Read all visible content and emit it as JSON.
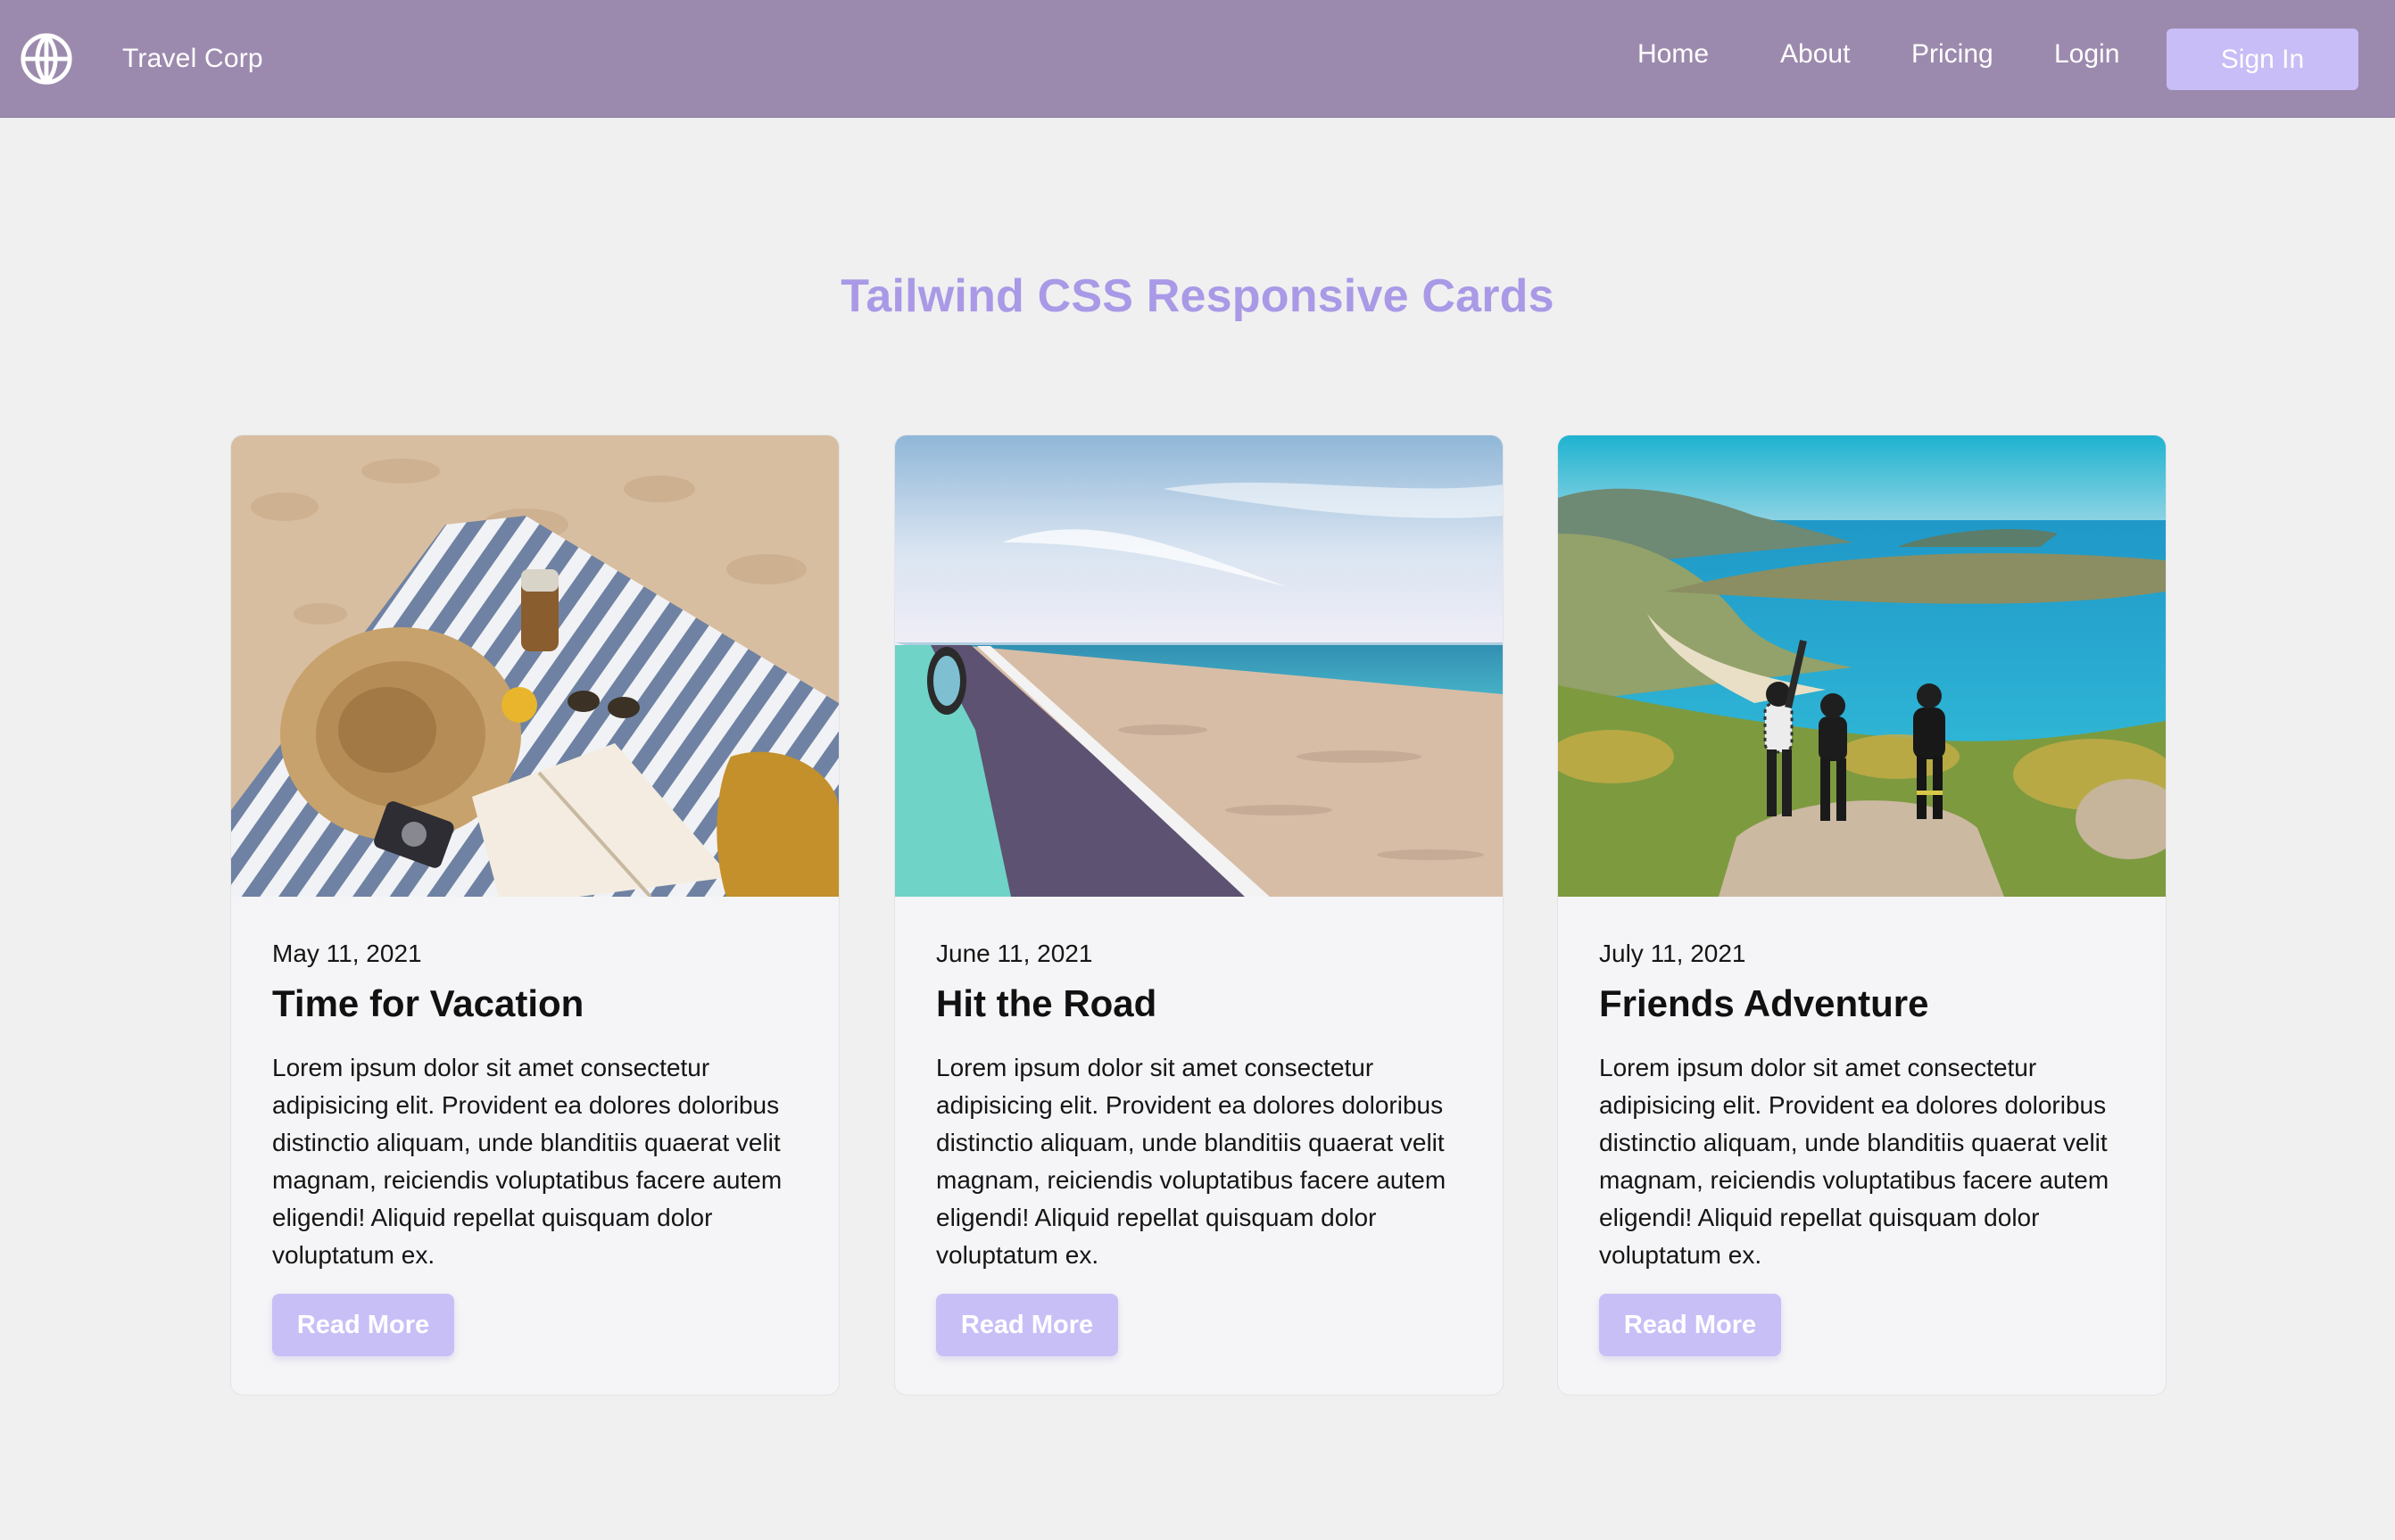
{
  "header": {
    "brand_icon": "globe-icon",
    "brand_name": "Travel Corp",
    "nav": {
      "home": "Home",
      "about": "About",
      "pricing": "Pricing",
      "login": "Login",
      "signin": "Sign In"
    },
    "background_color": "#9c8aae",
    "button_color": "#c8bdf6"
  },
  "page": {
    "title": "Tailwind CSS Responsive Cards",
    "title_color": "#a999e6",
    "background_color": "#f0f0f0"
  },
  "cards": [
    {
      "image": "beach-picnic-photo",
      "date": "May 11, 2021",
      "title": "Time for Vacation",
      "text": "Lorem ipsum dolor sit amet consectetur adipisicing elit. Provident ea dolores doloribus distinctio aliquam, unde blanditiis quaerat velit magnam, reiciendis voluptatibus facere autem eligendi! Aliquid repellat quisquam dolor voluptatum ex.",
      "button": "Read More"
    },
    {
      "image": "coastal-road-photo",
      "date": "June 11, 2021",
      "title": "Hit the Road",
      "text": "Lorem ipsum dolor sit amet consectetur adipisicing elit. Provident ea dolores doloribus distinctio aliquam, unde blanditiis quaerat velit magnam, reiciendis voluptatibus facere autem eligendi! Aliquid repellat quisquam dolor voluptatum ex.",
      "button": "Read More"
    },
    {
      "image": "friends-coast-hike-photo",
      "date": "July 11, 2021",
      "title": "Friends Adventure",
      "text": "Lorem ipsum dolor sit amet consectetur adipisicing elit. Provident ea dolores doloribus distinctio aliquam, unde blanditiis quaerat velit magnam, reiciendis voluptatibus facere autem eligendi! Aliquid repellat quisquam dolor voluptatum ex.",
      "button": "Read More"
    }
  ]
}
